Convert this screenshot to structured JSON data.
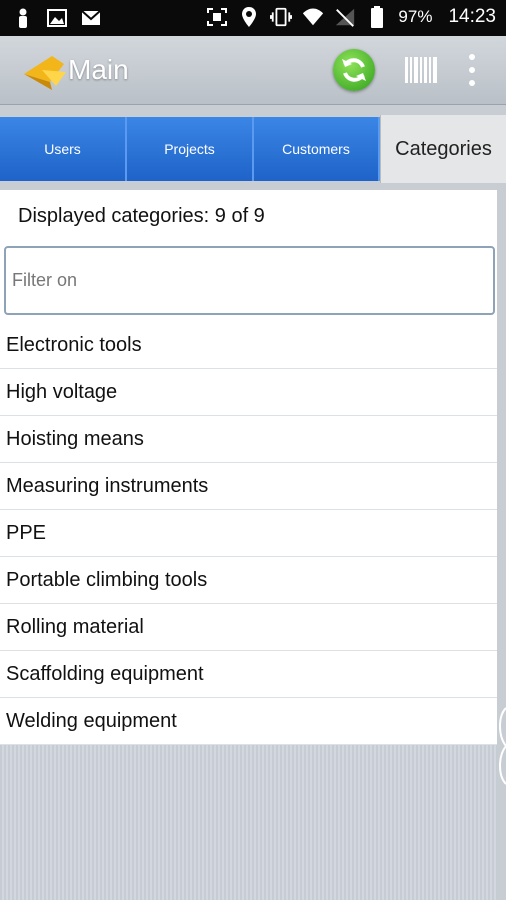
{
  "status_bar": {
    "battery": "97%",
    "time": "14:23",
    "icons": [
      "person-icon",
      "image-icon",
      "mail-icon",
      "scan-icon",
      "location-icon",
      "vibrate-icon",
      "wifi-icon",
      "no-signal-icon",
      "battery-icon"
    ]
  },
  "action_bar": {
    "title": "Main",
    "refresh_icon": "refresh-icon",
    "barcode_icon": "barcode-icon",
    "menu_icon": "overflow-menu-icon"
  },
  "tabs": [
    {
      "label": "Users",
      "active": false
    },
    {
      "label": "Projects",
      "active": false
    },
    {
      "label": "Customers",
      "active": false
    },
    {
      "label": "Categories",
      "active": true
    }
  ],
  "content": {
    "count_text": "Displayed categories: 9 of 9",
    "filter_placeholder": "Filter on",
    "filter_value": "",
    "categories": [
      "Electronic tools",
      "High voltage",
      "Hoisting means",
      "Measuring instruments",
      "PPE",
      "Portable climbing tools",
      "Rolling material",
      "Scaffolding equipment",
      "Welding equipment"
    ]
  },
  "colors": {
    "tab_blue": "#2a73d9",
    "refresh_green": "#3cb226",
    "status_bar": "#0a0a0a"
  }
}
